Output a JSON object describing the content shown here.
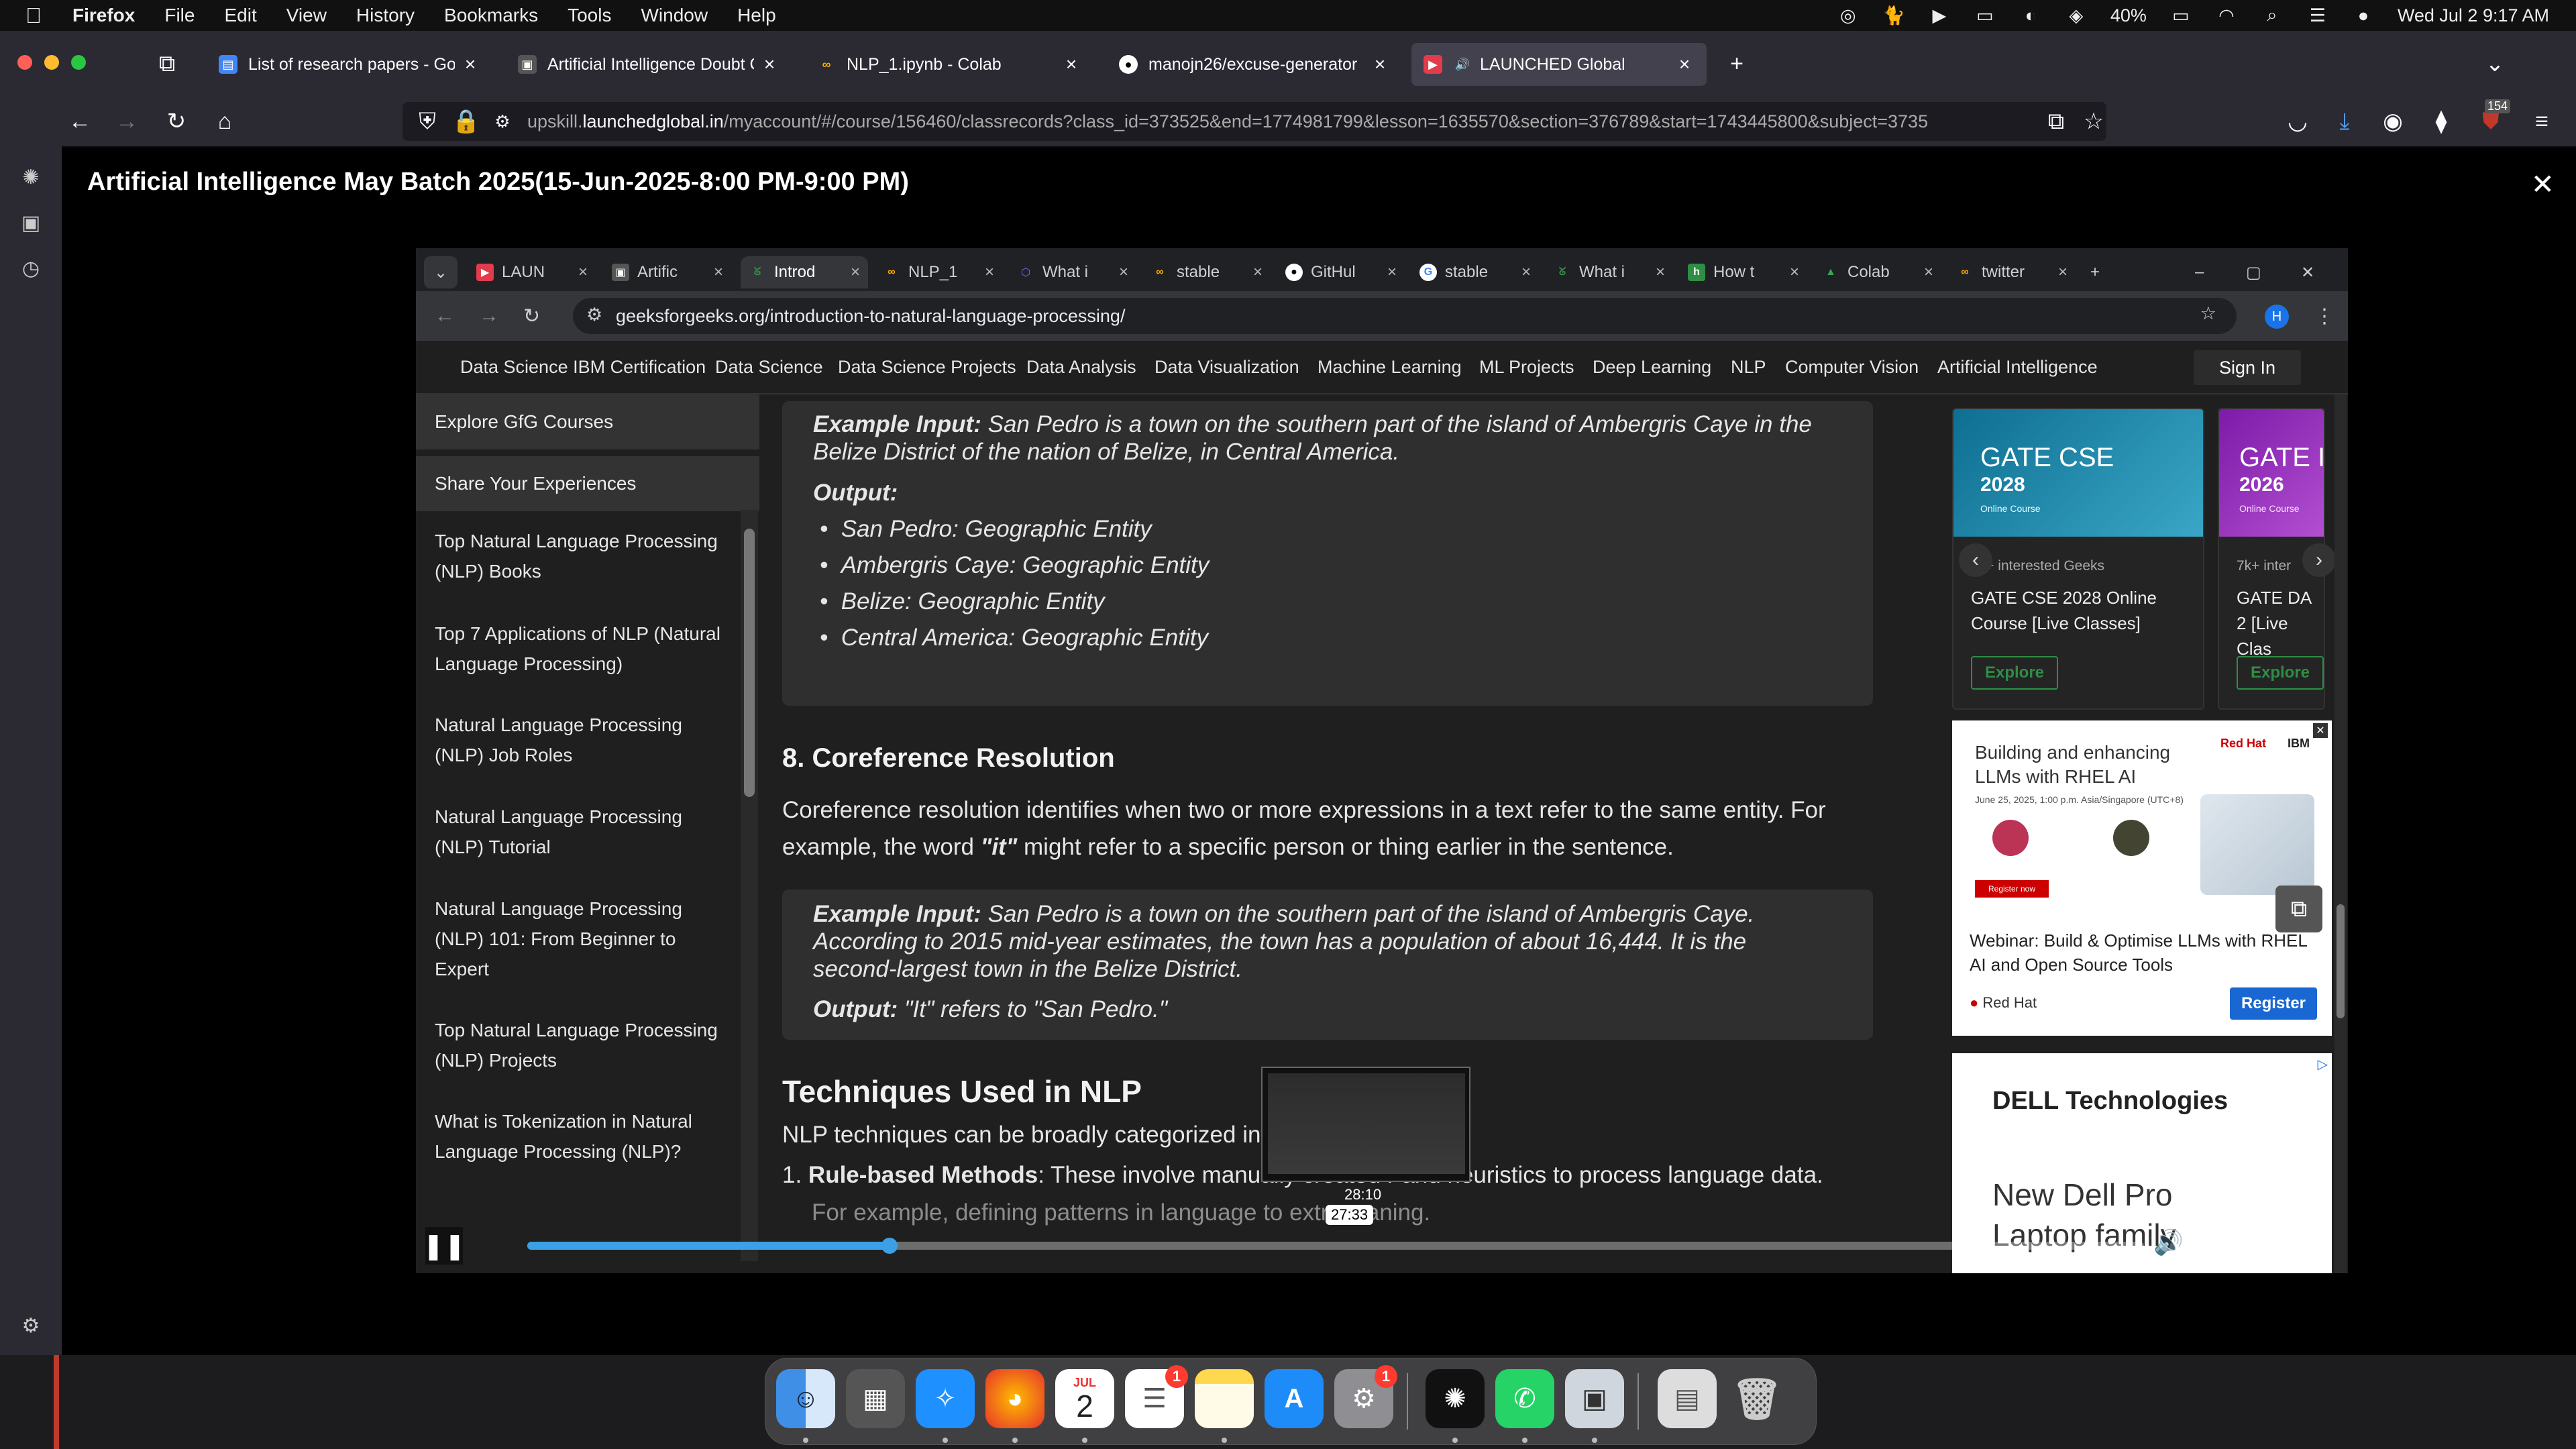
{
  "menubar": {
    "app": "Firefox",
    "items": [
      "File",
      "Edit",
      "View",
      "History",
      "Bookmarks",
      "Tools",
      "Window",
      "Help"
    ],
    "battery": "40%",
    "datetime": "Wed Jul 2  9:17 AM"
  },
  "firefox": {
    "tabs": [
      {
        "title": "List of research papers - Googl"
      },
      {
        "title": "Artificial Intelligence Doubt Cle"
      },
      {
        "title": "NLP_1.ipynb - Colab"
      },
      {
        "title": "manojn26/excuse-generator"
      },
      {
        "title": "LAUNCHED Global"
      }
    ],
    "url_prefix": "upskill.",
    "url_domain": "launchedglobal.in",
    "url_rest": "/myaccount/#/course/156460/classrecords?class_id=373525&end=1774981799&lesson=1635570&section=376789&start=1743445800&subject=3735",
    "ext_badge": "154"
  },
  "course": {
    "title": "Artificial Intelligence May Batch 2025(15-Jun-2025-8:00 PM-9:00 PM)",
    "close": "✕"
  },
  "chrome": {
    "tabs": [
      {
        "title": "LAUN"
      },
      {
        "title": "Artific"
      },
      {
        "title": "Introd"
      },
      {
        "title": "NLP_1"
      },
      {
        "title": "What i"
      },
      {
        "title": "stable"
      },
      {
        "title": "GitHul"
      },
      {
        "title": "stable"
      },
      {
        "title": "What i"
      },
      {
        "title": "How t"
      },
      {
        "title": "Colab"
      },
      {
        "title": "twitter"
      }
    ],
    "url": "geeksforgeeks.org/introduction-to-natural-language-processing/",
    "profile": "H"
  },
  "gfg": {
    "menu": [
      "Data Science IBM Certification",
      "Data Science",
      "Data Science Projects",
      "Data Analysis",
      "Data Visualization",
      "Machine Learning",
      "ML Projects",
      "Deep Learning",
      "NLP",
      "Computer Vision",
      "Artificial Intelligence"
    ],
    "signin": "Sign In",
    "sidebar_buttons": [
      "Explore GfG Courses",
      "Share Your Experiences"
    ],
    "sidebar_links": [
      "Top Natural Language Processing (NLP) Books",
      "Top 7 Applications of NLP (Natural Language Processing)",
      "Natural Language Processing (NLP) Job Roles",
      "Natural Language Processing (NLP) Tutorial",
      "Natural Language Processing (NLP) 101: From Beginner to Expert",
      "Top Natural Language Processing (NLP) Projects",
      "What is Tokenization in Natural Language Processing (NLP)?"
    ],
    "sidebar_cut": "Natural L"
  },
  "article": {
    "ex1_label": "Example Input:",
    "ex1_text": " San Pedro is a town on the southern part of the island of Ambergris Caye in the Belize District of the nation of Belize, in Central America.",
    "output_label": "Output:",
    "ex1_items": [
      "San Pedro: Geographic Entity",
      "Ambergris Caye: Geographic Entity",
      "Belize: Geographic Entity",
      "Central America: Geographic Entity"
    ],
    "h_coref": "8. Coreference Resolution",
    "coref_para_1": "Coreference resolution identifies when two or more expressions in a text refer to the same entity. For example, the word ",
    "coref_para_it": "\"it\"",
    "coref_para_2": " might refer to a specific person or thing earlier in the sentence.",
    "ex2_label": "Example Input:",
    "ex2_text": " San Pedro is a town on the southern part of the island of Ambergris Caye. According to 2015 mid-year estimates, the town has a population of about 16,444. It is the second-largest town in the Belize District.",
    "ex2_output_label": "Output:",
    "ex2_output": " \"It\" refers to \"San Pedro.\"",
    "h_tech": "Techniques Used in NLP",
    "tech_intro": "NLP techniques can be broadly categorized into two",
    "rule_label": "Rule-based Methods",
    "rule_text": ": These involve manually created r",
    "rule_text2": " and heuristics to process language data.",
    "rule_sub": "For example, defining patterns in language to extract ",
    "rule_sub2": "aning."
  },
  "ads": {
    "card1": {
      "img_title": "GATE CSE",
      "img_year": "2028",
      "img_sub": "Online Course",
      "interest": "1k+ interested Geeks",
      "title": "GATE CSE 2028 Online Course [Live Classes]",
      "btn": "Explore"
    },
    "card2": {
      "img_title": "GATE I",
      "img_year": "2026",
      "img_sub": "Online Course",
      "interest": "7k+ inter",
      "title": "GATE DA 2 [Live Clas",
      "btn": "Explore"
    },
    "redhat": {
      "headline": "Building and enhancing LLMs with RHEL AI",
      "date": "June 25, 2025, 1:00 p.m. Asia/Singapore (UTC+8)",
      "brand": "Red Hat",
      "ibm": "IBM",
      "register_small": "Register now",
      "title": "Webinar: Build & Optimise LLMs with RHEL AI and Open Source Tools",
      "company": "Red Hat",
      "btn": "Register"
    },
    "dell": {
      "logo": "DELL Technologies",
      "line1": "New Dell Pro",
      "line2": "Laptop family"
    }
  },
  "player": {
    "hover_time": "28:10",
    "current_time": "27:33",
    "progress": 0.224
  },
  "dock": {
    "calendar_month": "JUL",
    "calendar_day": "2",
    "reminders_badge": "1",
    "settings_badge": "1"
  },
  "colors": {
    "accent": "#3ba0e6",
    "gfg_green": "#2f8d46",
    "register": "#1967d2"
  }
}
